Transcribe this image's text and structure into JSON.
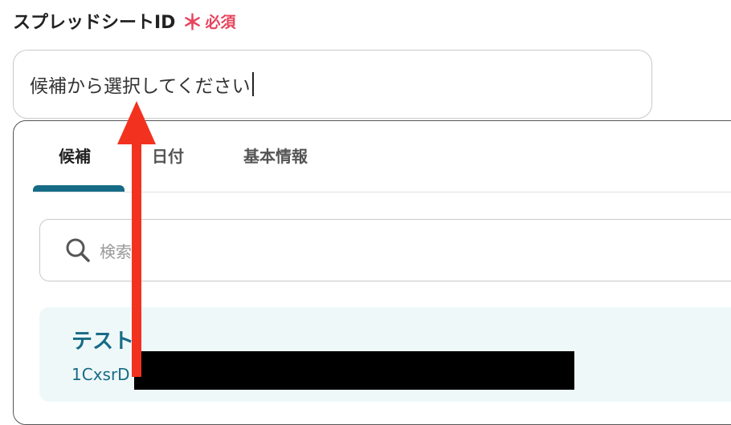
{
  "field": {
    "label": "スプレッドシートID",
    "required_mark": "＊",
    "required_text": "必須",
    "placeholder": "候補から選択してください"
  },
  "tabs": [
    {
      "label": "候補",
      "active": true
    },
    {
      "label": "日付",
      "active": false
    },
    {
      "label": "基本情報",
      "active": false
    }
  ],
  "search": {
    "placeholder": "検索"
  },
  "items": [
    {
      "title": "テスト",
      "id_prefix": "1CxsrD"
    }
  ],
  "colors": {
    "accent": "#166b86",
    "required": "#e8435d",
    "annotation_arrow": "#f2321f"
  },
  "icons": {
    "search": "search-icon"
  }
}
